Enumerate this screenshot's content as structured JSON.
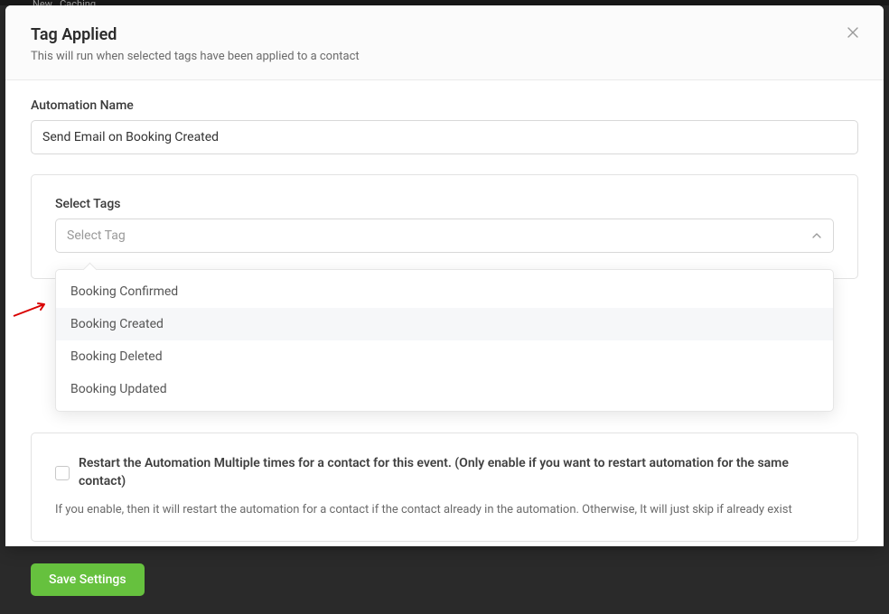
{
  "toolbar": {
    "hint_left": "New",
    "hint_right": "Caching"
  },
  "modal": {
    "title": "Tag Applied",
    "subtitle": "This will run when selected tags have been applied to a contact"
  },
  "form": {
    "name_label": "Automation Name",
    "name_value": "Send Email on Booking Created",
    "tags_label": "Select Tags",
    "tags_placeholder": "Select Tag",
    "tag_options": [
      {
        "label": "Booking Confirmed",
        "highlighted": false
      },
      {
        "label": "Booking Created",
        "highlighted": true
      },
      {
        "label": "Booking Deleted",
        "highlighted": false
      },
      {
        "label": "Booking Updated",
        "highlighted": false
      }
    ]
  },
  "restart": {
    "label": "Restart the Automation Multiple times for a contact for this event. (Only enable if you want to restart automation for the same contact)",
    "help": "If you enable, then it will restart the automation for a contact if the contact already in the automation. Otherwise, It will just skip if already exist"
  },
  "actions": {
    "save": "Save Settings"
  }
}
